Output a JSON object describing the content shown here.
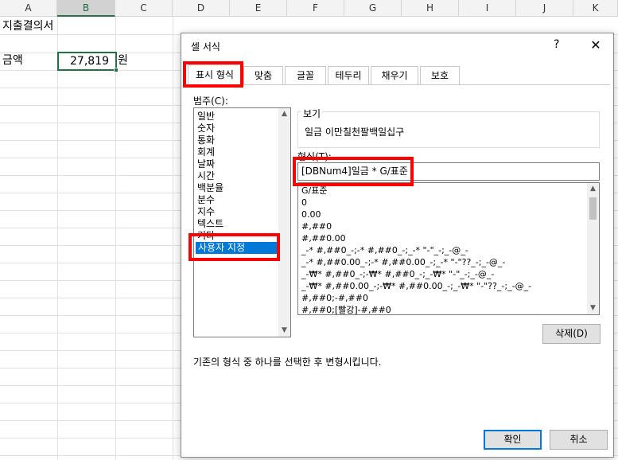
{
  "sheet": {
    "columns": [
      "A",
      "B",
      "C",
      "D",
      "E",
      "F",
      "G",
      "H",
      "I",
      "J",
      "K"
    ],
    "selected_column": "B",
    "cells": {
      "A2": "지출결의서",
      "A4": "금액",
      "B4": "27,819",
      "C4": "원"
    }
  },
  "dialog": {
    "title": "셀 서식",
    "help": "?",
    "close": "✕",
    "tabs": [
      "표시 형식",
      "맞춤",
      "글꼴",
      "테두리",
      "채우기",
      "보호"
    ],
    "active_tab": "표시 형식",
    "category_label": "범주(C):",
    "categories": [
      "일반",
      "숫자",
      "통화",
      "회계",
      "날짜",
      "시간",
      "백분율",
      "분수",
      "지수",
      "텍스트",
      "기타",
      "사용자 지정"
    ],
    "selected_category": "사용자 지정",
    "preview_label": "보기",
    "preview_value": "일금 이만칠천팔백일십구",
    "format_label": "형식(T):",
    "format_value": "[DBNum4]일금 * G/표준",
    "format_list": [
      "G/표준",
      "0",
      "0.00",
      "#,##0",
      "#,##0.00",
      "_-* #,##0_-;-* #,##0_-;_-* \"-\"_-;_-@_-",
      "_-* #,##0.00_-;-* #,##0.00_-;_-* \"-\"??_-;_-@_-",
      "_-₩* #,##0_-;-₩* #,##0_-;_-₩* \"-\"_-;_-@_-",
      "_-₩* #,##0.00_-;-₩* #,##0.00_-;_-₩* \"-\"??_-;_-@_-",
      "#,##0;-#,##0",
      "#,##0;[빨강]-#,##0"
    ],
    "delete_button": "삭제(D)",
    "description": "기존의 형식 중 하나를 선택한 후 변형시킵니다.",
    "ok_button": "확인",
    "cancel_button": "취소"
  },
  "colors": {
    "highlight": "#ff0000",
    "selection": "#0078d7",
    "excel_green": "#217346"
  }
}
